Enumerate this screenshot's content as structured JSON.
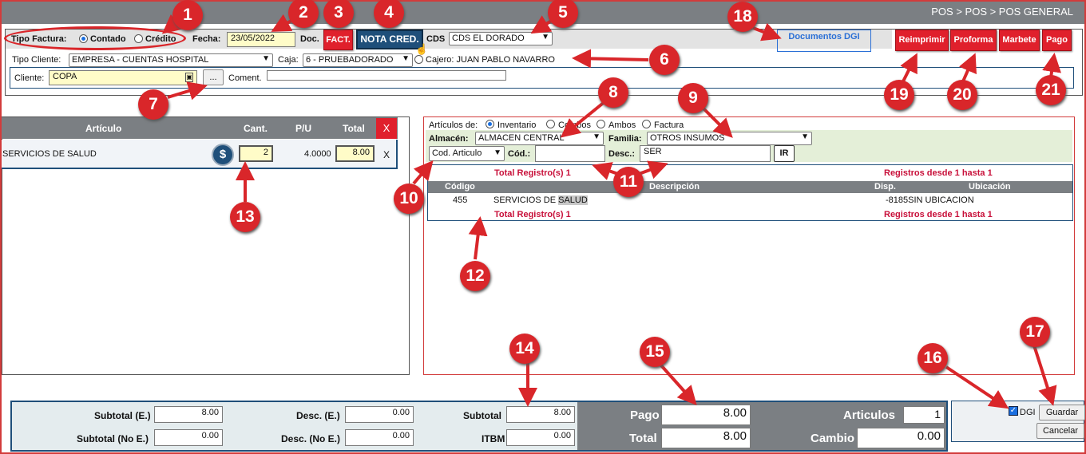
{
  "breadcrumb": "POS > POS > POS GENERAL",
  "header": {
    "tipo_factura_label": "Tipo Factura:",
    "contado_label": "Contado",
    "credito_label": "Crédito",
    "fecha_label": "Fecha:",
    "fecha_value": "23/05/2022",
    "doc_label": "Doc.",
    "fact_button": "FACT.",
    "nota_cred_button": "NOTA CRED.",
    "cds_label": "CDS",
    "cds_value": "CDS EL DORADO",
    "documentos_dgi_link": "Documentos DGI",
    "reimprimir_button": "Reimprimir",
    "proforma_button": "Proforma",
    "marbete_button": "Marbete",
    "pago_button": "Pago"
  },
  "client": {
    "tipo_cliente_label": "Tipo Cliente:",
    "tipo_cliente_value": "EMPRESA - CUENTAS HOSPITAL",
    "caja_label": "Caja:",
    "caja_value": "6 - PRUEBADORADO",
    "cajero_text": "Cajero: JUAN PABLO NAVARRO",
    "cliente_label": "Cliente:",
    "cliente_value": "COPA",
    "browse_button": "...",
    "coment_label": "Coment."
  },
  "cart": {
    "headers": {
      "articulo": "Artículo",
      "cant": "Cant.",
      "pu": "P/U",
      "total": "Total",
      "delete": "X"
    },
    "rows": [
      {
        "articulo": "SERVICIOS DE SALUD",
        "cant": "2",
        "pu": "4.0000",
        "total": "8.00",
        "remove": "X"
      }
    ]
  },
  "search": {
    "articulos_de_label": "Artículos de:",
    "options": [
      "Inventario",
      "Combos",
      "Ambos",
      "Factura"
    ],
    "almacen_label": "Almacén:",
    "almacen_value": "ALMACEN CENTRAL",
    "familia_label": "Familia:",
    "familia_value": "OTROS INSUMOS",
    "field_select": "Cod. Articulo",
    "cod_label": "Cód.:",
    "cod_value": "",
    "desc_label": "Desc.:",
    "desc_value": "SER",
    "ir_button": "IR",
    "total_registros": "Total Registro(s) 1",
    "registros_range": "Registros desde 1 hasta 1",
    "columns": {
      "codigo": "Código",
      "descripcion": "Descripción",
      "disp": "Disp.",
      "ubicacion": "Ubicación"
    },
    "results": [
      {
        "codigo": "455",
        "desc_prefix": "SERVICIOS DE ",
        "desc_highlight": "SALUD",
        "disp": "-8185",
        "ubicacion": "SIN UBICACION"
      }
    ]
  },
  "totals": {
    "subtotal_e_label": "Subtotal (E.)",
    "subtotal_e": "8.00",
    "subtotal_noe_label": "Subtotal (No E.)",
    "subtotal_noe": "0.00",
    "desc_e_label": "Desc. (E.)",
    "desc_e": "0.00",
    "desc_noe_label": "Desc. (No E.)",
    "desc_noe": "0.00",
    "subtotal_label": "Subtotal",
    "subtotal": "8.00",
    "itbm_label": "ITBM",
    "itbm": "0.00",
    "pago_label": "Pago",
    "pago": "8.00",
    "total_label": "Total",
    "total": "8.00",
    "articulos_label": "Articulos",
    "articulos": "1",
    "cambio_label": "Cambio",
    "cambio": "0.00"
  },
  "actions": {
    "dgi_label": "DGI",
    "guardar_button": "Guardar",
    "cancelar_button": "Cancelar"
  },
  "callouts": [
    "1",
    "2",
    "3",
    "4",
    "5",
    "6",
    "7",
    "8",
    "9",
    "10",
    "11",
    "12",
    "13",
    "14",
    "15",
    "16",
    "17",
    "18",
    "19",
    "20",
    "21"
  ],
  "colors": {
    "accent_red": "#e0202c",
    "header_grey": "#7b7f83",
    "nav_blue": "#1f4f7a",
    "input_yellow": "#fffcc8",
    "result_red_text": "#c8103a",
    "dgi_blue": "#2a6fd6"
  }
}
